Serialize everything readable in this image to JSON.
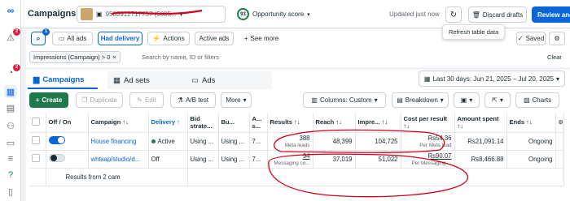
{
  "colors": {
    "accent": "#0a66d8",
    "create_green": "#1d7a4d",
    "annotation_red": "#d0021b"
  },
  "rail": {
    "items": [
      {
        "icon": "meta-logo-icon"
      },
      {
        "icon": "alert-icon",
        "badge": "2"
      },
      {
        "icon": "notifications-icon",
        "badge": "2"
      },
      {
        "icon": "table-icon"
      },
      {
        "icon": "reports-icon"
      },
      {
        "icon": "audiences-icon"
      },
      {
        "icon": "billing-icon"
      },
      {
        "icon": "menu-icon"
      },
      {
        "icon": "help-icon"
      },
      {
        "icon": "documents-icon"
      }
    ]
  },
  "header": {
    "title": "Campaigns",
    "account_id": "9503912717757 (5005...",
    "score_value": "93",
    "score_label": "Opportunity score",
    "updated": "Updated just now",
    "discard": "Discard drafts",
    "review": "Review and",
    "tooltip": "Refresh table data"
  },
  "filters": {
    "search_badge": "1",
    "views": [
      "All ads",
      "Had delivery",
      "Actions",
      "Active ads",
      "See more"
    ],
    "selected_view": "Had delivery",
    "saved": "Saved",
    "chip": "Impressions (Campaign) > 0",
    "search_placeholder": "Search by name, ID or filters",
    "clear": "Clear"
  },
  "tabs": [
    "Campaigns",
    "Ad sets",
    "Ads"
  ],
  "date_range": "Last 30 days: Jun 21, 2025 – Jul 20, 2025",
  "toolbar": {
    "create": "Create",
    "duplicate": "Duplicate",
    "edit": "Edit",
    "ab_test": "A/B test",
    "more": "More",
    "columns": "Columns: Custom",
    "breakdown": "Breakdown",
    "charts": "Charts"
  },
  "table": {
    "headers": {
      "onoff": "Off / On",
      "campaign": "Campaign ↑↓",
      "delivery": "Delivery ↑",
      "bid": "Bid strate...",
      "budget": "Bu...",
      "attr": "A... s...",
      "results": "Results ↑↓",
      "reach": "Reach ↑↓",
      "impr": "Impre... ↑↓",
      "cpr": "Cost per result ↑↓",
      "spent": "Amount spent ↑↓",
      "ends": "Ends ↑↓"
    },
    "rows": [
      {
        "name": "House financing",
        "delivery": "Active",
        "bid": "Using ...",
        "budget": "Using ...",
        "attr": "7...",
        "results": "388",
        "results_sub": "Meta leads",
        "reach": "48,399",
        "impressions": "104,725",
        "cpr": "Rs54.36",
        "cpr_sub": "Per Meta lead",
        "spent": "Rs21,091.14",
        "ends": "Ongoing",
        "on": true
      },
      {
        "name": "whtsap/studio/d...",
        "delivery": "Off",
        "bid": "Using ...",
        "budget": "Using ...",
        "attr": "7...",
        "results": "94",
        "results_sub": "Messaging co...",
        "reach": "37,019",
        "impressions": "51,022",
        "cpr": "Rs90.07",
        "cpr_sub": "Per Messaging ...",
        "spent": "Rs8,466.88",
        "ends": "Ongoing",
        "on": false
      }
    ],
    "footer": "Results from 2 cam"
  }
}
